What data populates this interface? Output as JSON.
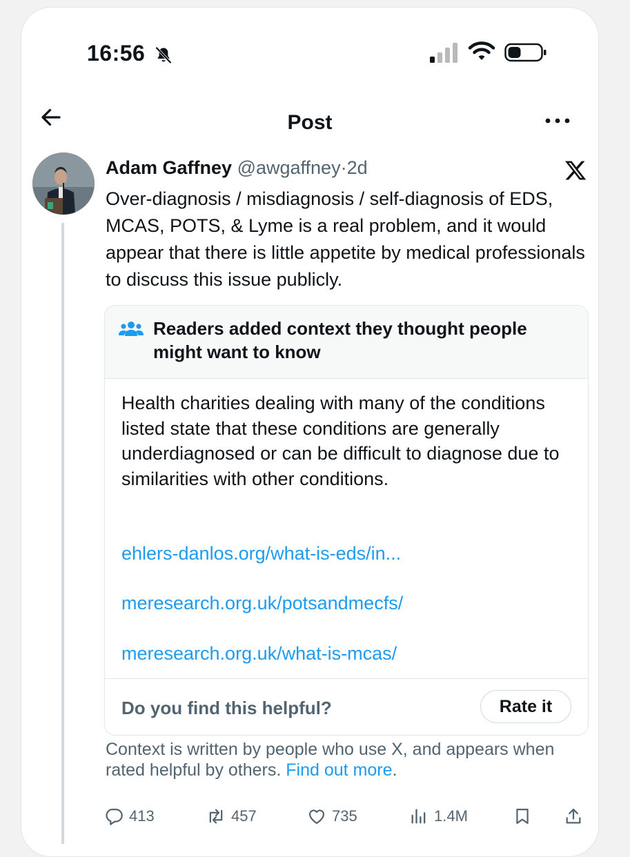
{
  "status_bar": {
    "time": "16:56",
    "icons": [
      "bell-slash-icon",
      "cellular-signal-icon",
      "wifi-icon",
      "battery-icon"
    ]
  },
  "header": {
    "title": "Post",
    "back_icon": "arrow-left-icon",
    "more_icon": "more-horizontal-icon"
  },
  "post": {
    "author_name": "Adam Gaffney",
    "author_handle": "@awgaffney",
    "separator": "·",
    "time": "2d",
    "platform_icon": "x-logo-icon",
    "text": "Over-diagnosis / misdiagnosis / self-diagnosis of EDS, MCAS, POTS, & Lyme is a real problem, and it would appear that there is little appetite by medical professionals to discuss this issue publicly."
  },
  "community_note": {
    "header_icon": "readers-icon",
    "header_text": "Readers added context they thought people might want to know",
    "body": "Health charities dealing with many of the conditions listed state that these conditions are generally underdiagnosed or can be difficult to diagnose due to similarities with other conditions.",
    "links": [
      "ehlers-danlos.org/what-is-eds/in...",
      "meresearch.org.uk/potsandmecfs/",
      "meresearch.org.uk/what-is-mcas/"
    ],
    "helpful_question": "Do you find this helpful?",
    "rate_button": "Rate it"
  },
  "context_footer": {
    "text": "Context is written by people who use X, and appears when rated helpful by others.",
    "link": "Find out more",
    "trailing": "."
  },
  "actions": {
    "replies": "413",
    "reposts": "457",
    "likes": "735",
    "views": "1.4M",
    "icons": [
      "reply-icon",
      "repost-icon",
      "like-icon",
      "views-icon",
      "bookmark-icon",
      "share-icon"
    ]
  },
  "colors": {
    "link": "#1d9bf0",
    "secondary_text": "#536471",
    "primary_text": "#0f1419",
    "note_header_bg": "#f7f9f9"
  }
}
